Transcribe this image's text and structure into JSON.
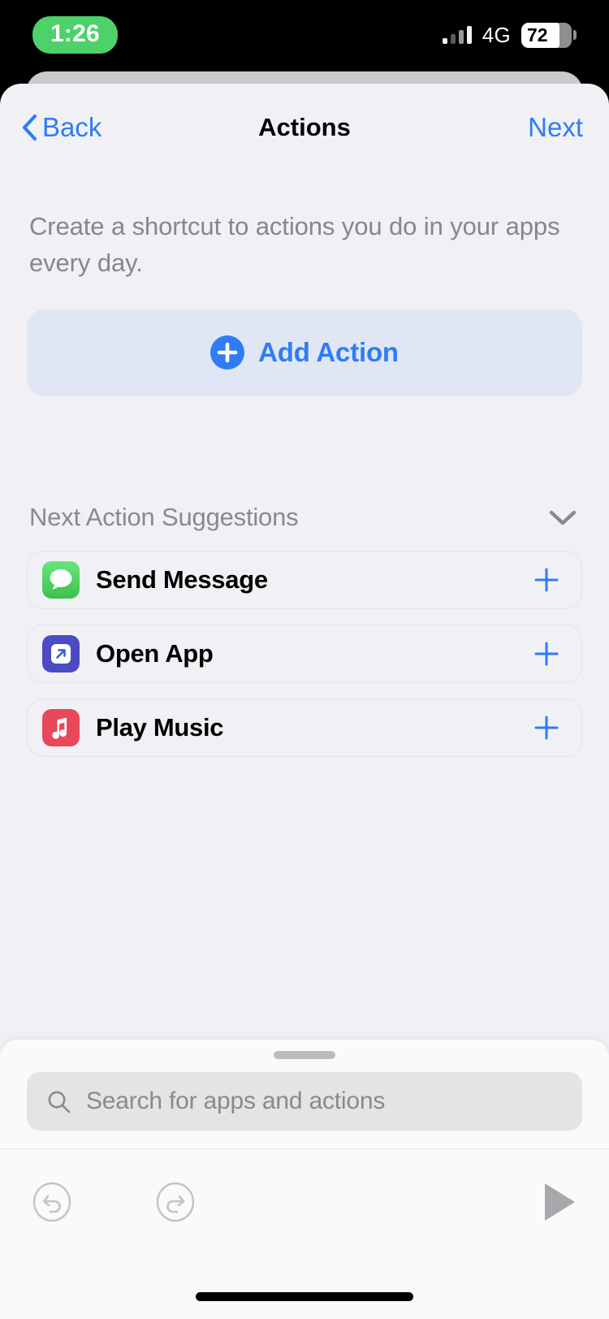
{
  "status_bar": {
    "time": "1:26",
    "time_pill_color": "#4CD269",
    "network": "4G",
    "battery_percent": "72",
    "signal_icon": "signal-bars-icon",
    "battery_icon": "battery-icon"
  },
  "nav": {
    "back_label": "Back",
    "title": "Actions",
    "next_label": "Next",
    "accent_color": "#2F7CF6"
  },
  "main": {
    "description": "Create a shortcut to actions you do in your apps every day.",
    "add_action_label": "Add Action",
    "add_action_bg": "#E0E6F4",
    "suggestions_title": "Next Action Suggestions",
    "suggestions": [
      {
        "label": "Send Message",
        "icon": "messages-app-icon",
        "icon_color": "#5CD66F",
        "add_icon": "plus-icon"
      },
      {
        "label": "Open App",
        "icon": "open-app-icon",
        "icon_color": "#4C4BC4",
        "add_icon": "plus-icon"
      },
      {
        "label": "Play Music",
        "icon": "music-app-icon",
        "icon_color": "#E8485A",
        "add_icon": "plus-icon"
      }
    ]
  },
  "bottom_sheet": {
    "grab_handle": "grab-handle",
    "search": {
      "placeholder": "Search for apps and actions",
      "value": "",
      "icon": "search-icon"
    },
    "toolbar": {
      "undo": "undo-icon",
      "redo": "redo-icon",
      "play": "play-icon"
    }
  }
}
